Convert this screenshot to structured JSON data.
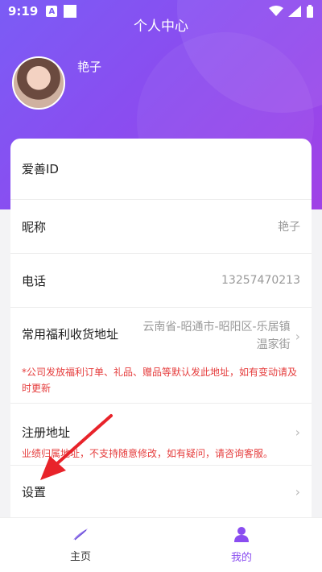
{
  "statusbar": {
    "time": "9:19",
    "a_badge": "A"
  },
  "header": {
    "title": "个人中心",
    "username": "艳子"
  },
  "rows": [
    {
      "label": "爱善ID",
      "value": ""
    },
    {
      "label": "昵称",
      "value": "艳子"
    },
    {
      "label": "电话",
      "value": "13257470213"
    },
    {
      "label": "常用福利收货地址",
      "value": "云南省-昭通市-昭阳区-乐居镇温家街",
      "note": "*公司发放福利订单、礼品、赠品等默认发此地址，如有变动请及时更新"
    },
    {
      "label": "注册地址",
      "value": "",
      "note": "业绩归属地址，不支持随意修改，如有疑问，请咨询客服。"
    },
    {
      "label": "设置",
      "value": ""
    }
  ],
  "tabs": [
    {
      "label": "主页"
    },
    {
      "label": "我的"
    }
  ],
  "colors": {
    "accent": "#8a4df0",
    "warning": "#e53c3c",
    "header_start": "#7b5cf5",
    "header_end": "#a042e6"
  }
}
